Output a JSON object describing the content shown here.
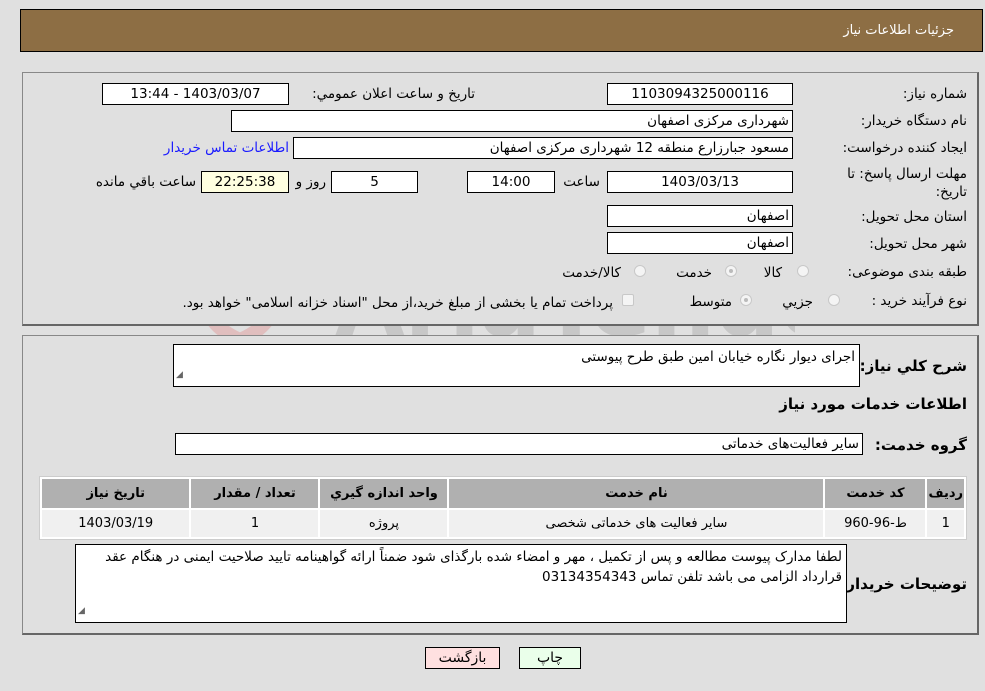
{
  "header": {
    "title": "جزئیات اطلاعات نیاز"
  },
  "form": {
    "need_number": {
      "label": "شماره نیاز:",
      "value": "1103094325000116"
    },
    "announce_datetime": {
      "label": "تاریخ و ساعت اعلان عمومي:",
      "value": "1403/03/07 - 13:44"
    },
    "buyer_org": {
      "label": "نام دستگاه خريدار:",
      "value": "شهرداری مرکزی اصفهان"
    },
    "requester": {
      "label": "ایجاد کننده درخواست:",
      "value": "مسعود جبارزارع منطقه 12 شهرداری مرکزی اصفهان"
    },
    "buyer_contact_link": "اطلاعات تماس خريدار",
    "deadline": {
      "label": "مهلت ارسال پاسخ: تا تاریخ:",
      "date": "1403/03/13",
      "time_label": "ساعت",
      "time": "14:00",
      "days": "5",
      "days_label": "روز و",
      "remaining": "22:25:38",
      "remaining_label": "ساعت باقي مانده"
    },
    "province": {
      "label": "استان محل تحویل:",
      "value": "اصفهان"
    },
    "city": {
      "label": "شهر محل تحویل:",
      "value": "اصفهان"
    },
    "category": {
      "label": "طبقه بندی موضوعی:",
      "options": [
        "کالا",
        "خدمت",
        "کالا/خدمت"
      ],
      "selected": "خدمت"
    },
    "purchase_type": {
      "label": "نوع فرآیند خرید :",
      "options": [
        "جزيي",
        "متوسط"
      ],
      "selected": "متوسط",
      "treasury_note": "پرداخت تمام یا بخشی از مبلغ خرید،از محل \"اسناد خزانه اسلامی\" خواهد بود."
    }
  },
  "details": {
    "summary_label": "شرح کلي نياز:",
    "summary_value": "اجرای دیوار نگاره خیابان امین طبق طرح پیوستی",
    "services_title": "اطلاعات خدمات مورد نياز",
    "service_group_label": "گروه خدمت:",
    "service_group_value": "سایر فعالیت‌های خدماتی",
    "table": {
      "headers": [
        "رديف",
        "کد خدمت",
        "نام خدمت",
        "واحد اندازه گيري",
        "تعداد / مقدار",
        "تاريخ نياز"
      ],
      "rows": [
        [
          "1",
          "ط-96-960",
          "سایر فعالیت های خدماتی شخصی",
          "پروژه",
          "1",
          "1403/03/19"
        ]
      ]
    },
    "buyer_notes_label": "توضيحات خريدار:",
    "buyer_notes_value": "لطفا مدارک پیوست مطالعه و پس از تکمیل ، مهر و امضاء شده بارگذای شود ضمناً ارائه گواهینامه تایید صلاحیت ایمنی در هنگام عقد قرارداد الزامی می باشد تلفن تماس 03134354343"
  },
  "buttons": {
    "print": "چاپ",
    "back": "بازگشت"
  },
  "colors": {
    "header_bg": "#8d6e44",
    "print_bg": "#eaffea",
    "back_bg": "#ffe0e0",
    "link": "#1a1aff"
  }
}
